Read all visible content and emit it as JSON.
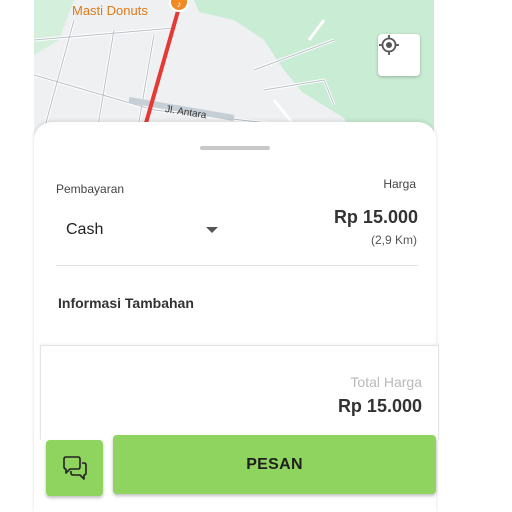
{
  "map": {
    "poi_label": "Masti Donuts",
    "road_label": "Jl. Antara",
    "locate_icon": "crosshair-icon",
    "route_color": "#e53935"
  },
  "sheet": {
    "payment_label": "Pembayaran",
    "payment_value": "Cash",
    "price_label": "Harga",
    "price_value": "Rp 15.000",
    "distance": "(2,9 Km)",
    "info_title": "Informasi Tambahan"
  },
  "total": {
    "label": "Total Harga",
    "value": "Rp 15.000"
  },
  "actions": {
    "chat_icon": "chat-bubbles-icon",
    "order_label": "PESAN"
  },
  "colors": {
    "accent": "#8fd45e",
    "poi": "#e07a1a"
  }
}
